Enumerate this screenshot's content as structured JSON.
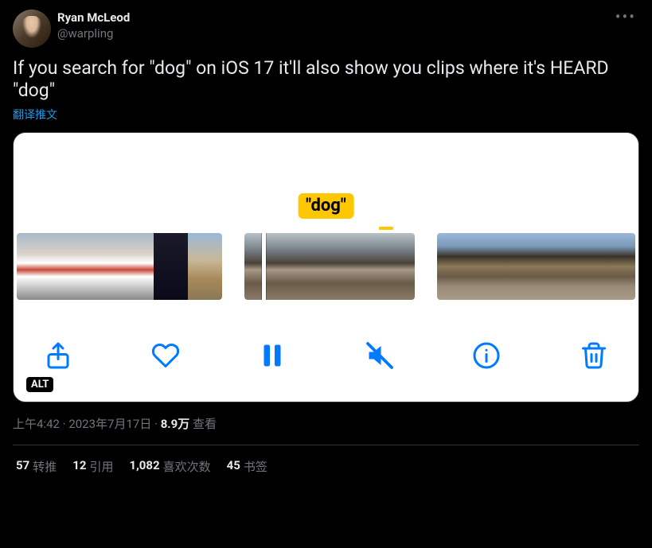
{
  "author": {
    "display_name": "Ryan McLeod",
    "handle": "@warpling"
  },
  "tweet_text": "If you search for \"dog\" on iOS 17 it'll also show you clips where it's HEARD \"dog\"",
  "translate_label": "翻译推文",
  "media": {
    "tooltip": "\"dog\"",
    "alt_badge": "ALT"
  },
  "meta": {
    "time": "上午4:42",
    "sep1": " · ",
    "date": "2023年7月17日",
    "sep2": " · ",
    "views_num": "8.9万",
    "views_label": " 查看"
  },
  "stats": {
    "retweets_num": "57",
    "retweets_label": "转推",
    "quotes_num": "12",
    "quotes_label": "引用",
    "likes_num": "1,082",
    "likes_label": "喜欢次数",
    "bookmarks_num": "45",
    "bookmarks_label": "书签"
  }
}
